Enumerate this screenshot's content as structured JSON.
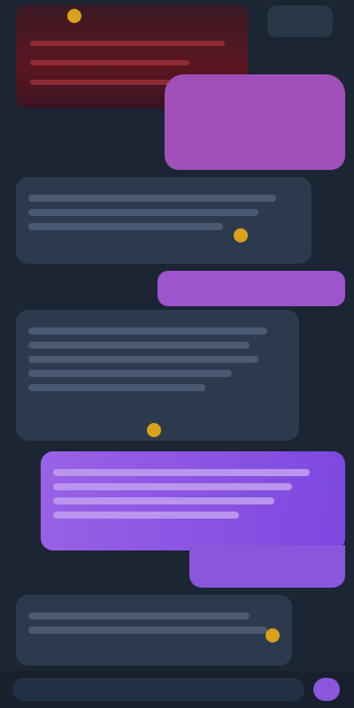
{
  "colors": {
    "background": "#1b2533",
    "incoming_bubble": "#2d3a4d",
    "outgoing_pink": "#a14fb9",
    "outgoing_purple": "#9e54cc",
    "outgoing_gradient_start": "#9a62e6",
    "outgoing_gradient_end": "#7c47e0"
  },
  "icons": {
    "banner_emoji": "emoji-icon",
    "incoming_emoji": "emoji-icon",
    "send": "send-icon"
  }
}
